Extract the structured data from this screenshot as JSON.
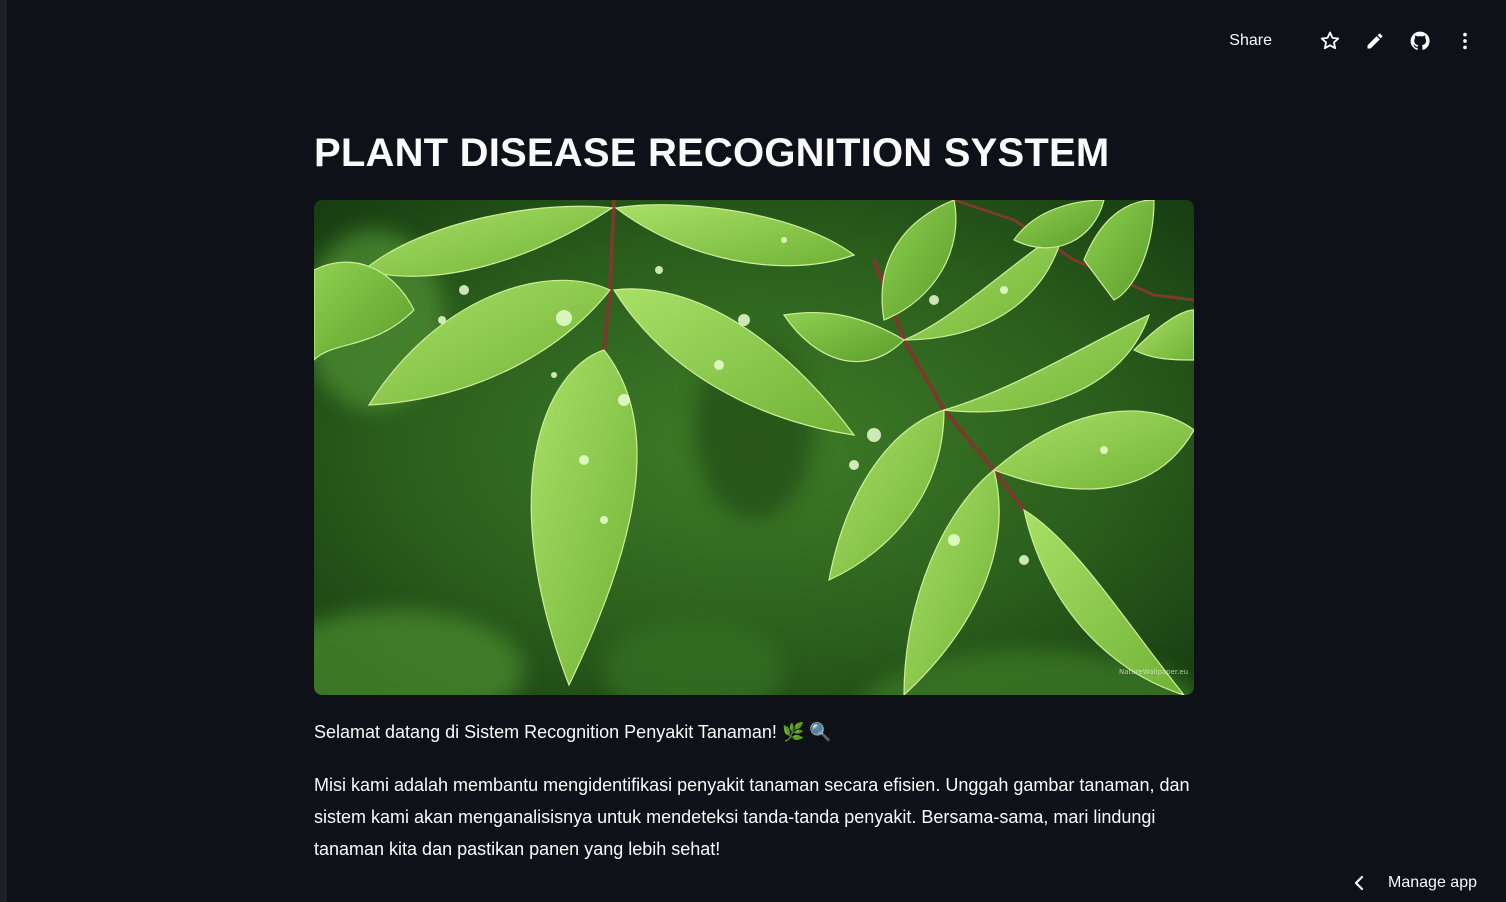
{
  "header": {
    "share_label": "Share",
    "icons": [
      "star-icon",
      "pencil-icon",
      "github-icon",
      "more-vertical-icon"
    ]
  },
  "main": {
    "title": "PLANT DISEASE RECOGNITION SYSTEM",
    "image": {
      "watermark": "NatureWallpaper.eu"
    },
    "welcome_text": "Selamat datang di Sistem Recognition Penyakit Tanaman! 🌿 🔍",
    "mission_text": "Misi kami adalah membantu mengidentifikasi penyakit tanaman secara efisien. Unggah gambar tanaman, dan sistem kami akan menganalisisnya untuk mendeteksi tanda-tanda penyakit. Bersama-sama, mari lindungi tanaman kita dan pastikan panen yang lebih sehat!"
  },
  "footer": {
    "manage_label": "Manage app"
  },
  "colors": {
    "background": "#0e1117",
    "text": "#fafafa",
    "leaf": "#8ccf4d"
  }
}
